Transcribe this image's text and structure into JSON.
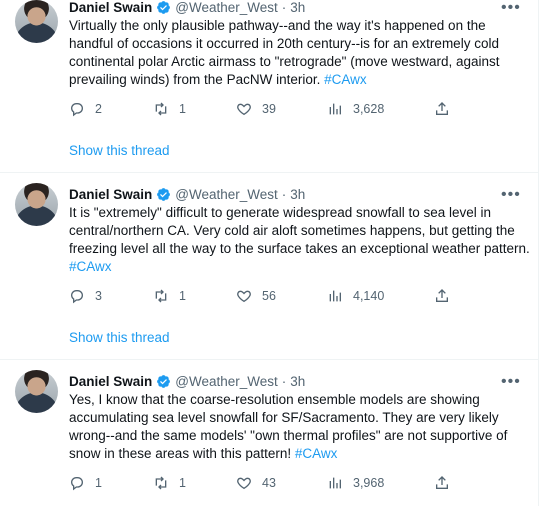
{
  "tweets": [
    {
      "name": "Daniel Swain",
      "handle": "@Weather_West",
      "separator": "·",
      "time": "3h",
      "text": "Virtually the only plausible pathway--and the way it's happened on the handful of occasions it occurred in 20th century--is for an extremely cold continental polar Arctic airmass to \"retrograde\" (move westward, against prevailing winds) from the PacNW interior.",
      "hashtag": "#CAwx",
      "replies": "2",
      "retweets": "1",
      "likes": "39",
      "views": "3,628",
      "show_thread": "Show this thread"
    },
    {
      "name": "Daniel Swain",
      "handle": "@Weather_West",
      "separator": "·",
      "time": "3h",
      "text": "It is \"extremely\" difficult to generate widespread snowfall to sea level in central/northern CA. Very cold air aloft sometimes happens, but getting the freezing level all the way to the surface takes an exceptional weather pattern.",
      "hashtag": "#CAwx",
      "replies": "3",
      "retweets": "1",
      "likes": "56",
      "views": "4,140",
      "show_thread": "Show this thread"
    },
    {
      "name": "Daniel Swain",
      "handle": "@Weather_West",
      "separator": "·",
      "time": "3h",
      "text": "Yes, I know that the coarse-resolution ensemble models are showing accumulating sea level snowfall for SF/Sacramento. They are very likely wrong--and the same models' \"own thermal profiles\" are not supportive of snow in these areas with this pattern!",
      "hashtag": "#CAwx",
      "replies": "1",
      "retweets": "1",
      "likes": "43",
      "views": "3,968"
    }
  ],
  "colors": {
    "accent": "#1d9bf0",
    "muted": "#536471",
    "text": "#0f1419",
    "divider": "#eff3f4"
  },
  "icons": [
    "verified-badge-icon",
    "more-icon",
    "reply-icon",
    "retweet-icon",
    "like-icon",
    "views-icon",
    "share-icon"
  ]
}
